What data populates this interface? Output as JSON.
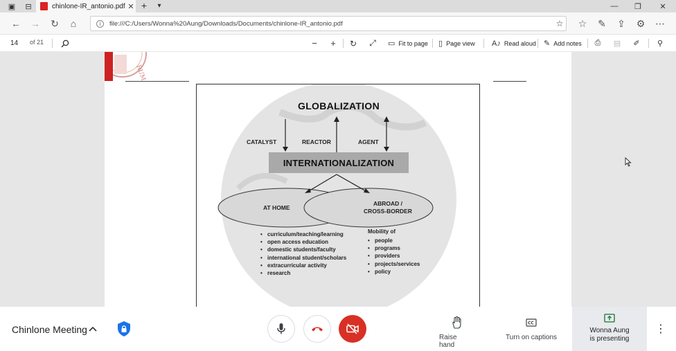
{
  "browser": {
    "tab_title": "chinlone-IR_antonio.pdf",
    "tab_close": "✕",
    "new_tab": "+",
    "url": "file:///C:/Users/Wonna%20Aung/Downloads/Documents/chinlone-IR_antonio.pdf"
  },
  "pdf_toolbar": {
    "page_number": "14",
    "page_total": "of 21",
    "fit_to_page": "Fit to page",
    "page_view": "Page view",
    "read_aloud": "Read aloud",
    "add_notes": "Add notes"
  },
  "figure": {
    "title": "GLOBALIZATION",
    "labels": {
      "catalyst": "CATALYST",
      "reactor": "REACTOR",
      "agent": "AGENT"
    },
    "center": "INTERNATIONALIZATION",
    "at_home": "AT HOME",
    "abroad_line1": "ABROAD /",
    "abroad_line2": "CROSS-BORDER",
    "home_items": [
      "curriculum/teaching/learning",
      "open access education",
      "domestic students/faculty",
      "international student/scholars",
      "extracurricular activity",
      "research"
    ],
    "mobility_heading": "Mobility of",
    "mobility_items": [
      "people",
      "programs",
      "providers",
      "projects/services",
      "policy"
    ]
  },
  "meeting": {
    "name": "Chinlone Meeting",
    "raise_hand": "Raise hand",
    "captions": "Turn on captions",
    "presenter_line1": "Wonna Aung",
    "presenter_line2": "is presenting"
  },
  "colors": {
    "hangup_red": "#d93025",
    "presenting_bg": "#e8eaed",
    "pdf_badge": "#dd2222",
    "shield_blue": "#1a73e8"
  }
}
